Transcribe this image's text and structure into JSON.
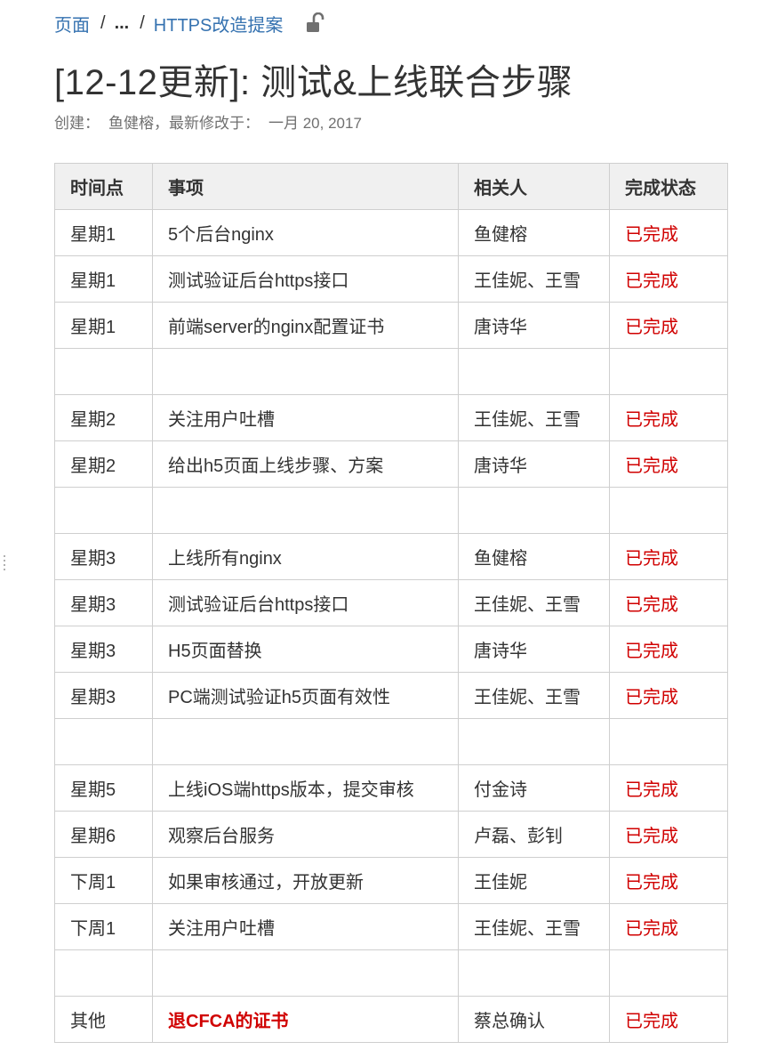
{
  "breadcrumb": {
    "root": "页面",
    "separator": "/",
    "ellipsis": "...",
    "parent": "HTTPS改造提案"
  },
  "page": {
    "title": "[12-12更新]: 测试&上线联合步骤",
    "created_label": "创建：",
    "author": "鱼健榕，",
    "modified_label": "最新修改于：",
    "modified_date": "一月 20, 2017"
  },
  "colors": {
    "link": "#3572b0",
    "status_done": "#d00000",
    "header_bg": "#f0f0f0",
    "border": "#cfcfcf"
  },
  "table": {
    "headers": [
      "时间点",
      "事项",
      "相关人",
      "完成状态"
    ],
    "rows": [
      {
        "time": "星期1",
        "item": "5个后台nginx",
        "people": "鱼健榕",
        "status": "已完成"
      },
      {
        "time": "星期1",
        "item": "测试验证后台https接口",
        "people": "王佳妮、王雪",
        "status": "已完成"
      },
      {
        "time": "星期1",
        "item": "前端server的nginx配置证书",
        "people": "唐诗华",
        "status": "已完成"
      },
      {
        "time": "",
        "item": "",
        "people": "",
        "status": ""
      },
      {
        "time": "星期2",
        "item": "关注用户吐槽",
        "people": "王佳妮、王雪",
        "status": "已完成"
      },
      {
        "time": "星期2",
        "item": "给出h5页面上线步骤、方案",
        "people": "唐诗华",
        "status": "已完成"
      },
      {
        "time": "",
        "item": "",
        "people": "",
        "status": ""
      },
      {
        "time": "星期3",
        "item": "上线所有nginx",
        "people": "鱼健榕",
        "status": "已完成"
      },
      {
        "time": "星期3",
        "item": "测试验证后台https接口",
        "people": "王佳妮、王雪",
        "status": "已完成"
      },
      {
        "time": "星期3",
        "item": "H5页面替换",
        "people": "唐诗华",
        "status": "已完成"
      },
      {
        "time": "星期3",
        "item": "PC端测试验证h5页面有效性",
        "people": "王佳妮、王雪",
        "status": "已完成"
      },
      {
        "time": "",
        "item": "",
        "people": "",
        "status": ""
      },
      {
        "time": "星期5",
        "item": "上线iOS端https版本，提交审核",
        "people": "付金诗",
        "status": "已完成"
      },
      {
        "time": "星期6",
        "item": "观察后台服务",
        "people": "卢磊、彭钊",
        "status": "已完成"
      },
      {
        "time": "下周1",
        "item": "如果审核通过，开放更新",
        "people": "王佳妮",
        "status": "已完成"
      },
      {
        "time": "下周1",
        "item": "关注用户吐槽",
        "people": "王佳妮、王雪",
        "status": "已完成"
      },
      {
        "time": "",
        "item": "",
        "people": "",
        "status": ""
      },
      {
        "time": "其他",
        "item": "退CFCA的证书",
        "people": "蔡总确认",
        "status": "已完成",
        "item_highlight": true
      }
    ]
  }
}
